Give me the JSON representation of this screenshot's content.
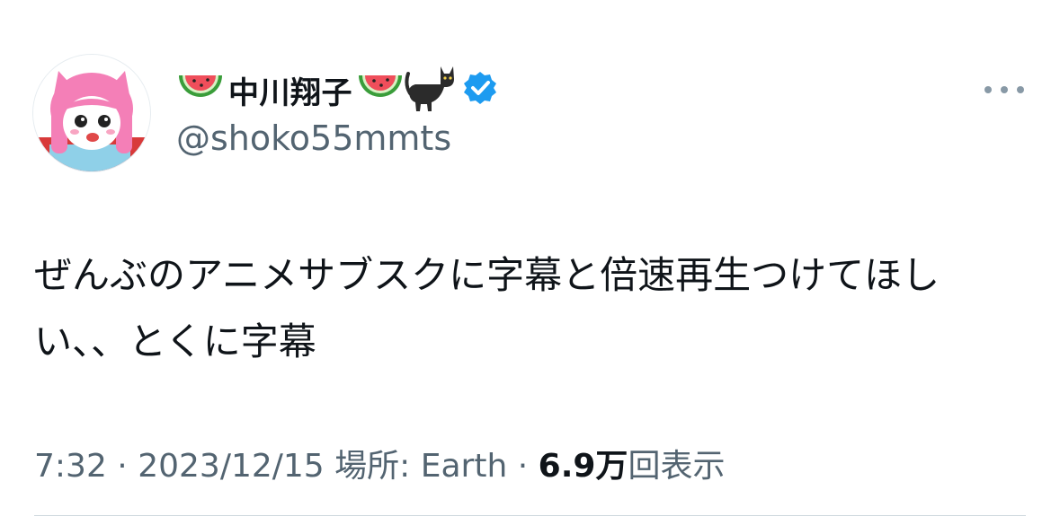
{
  "tweet": {
    "display_name": "中川翔子",
    "handle": "@shoko55mmts",
    "verified": true,
    "name_emojis": [
      "watermelon-icon",
      "watermelon-icon",
      "black-cat-icon"
    ],
    "text": "ぜんぶのアニメサブスクに字幕と倍速再生つけてほしい、、とくに字幕",
    "time": "7:32",
    "separator": "·",
    "date": "2023/12/15",
    "location_label": "場所:",
    "location": "Earth",
    "views_count": "6.9万",
    "views_label": "回表示"
  },
  "colors": {
    "text": "#0f1419",
    "secondary": "#536471",
    "verified": "#1d9bf0",
    "divider": "#cfd9de"
  }
}
